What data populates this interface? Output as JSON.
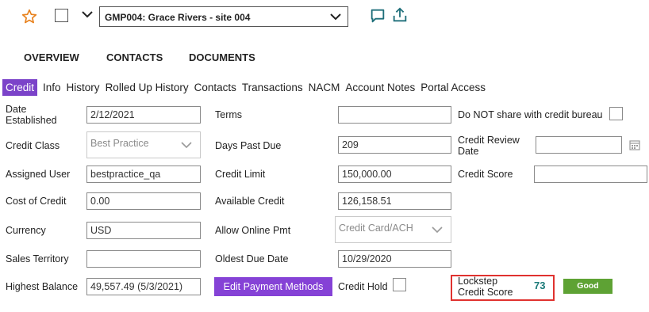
{
  "header": {
    "account_select": "GMP004: Grace Rivers - site 004"
  },
  "main_tabs": [
    "OVERVIEW",
    "CONTACTS",
    "DOCUMENTS"
  ],
  "sub_tabs": [
    "Credit",
    "Info",
    "History",
    "Rolled Up History",
    "Contacts",
    "Transactions",
    "NACM",
    "Account Notes",
    "Portal Access"
  ],
  "fields": {
    "date_established": {
      "label": "Date Established",
      "value": "2/12/2021"
    },
    "credit_class": {
      "label": "Credit Class",
      "value": "Best Practice"
    },
    "assigned_user": {
      "label": "Assigned User",
      "value": "bestpractice_qa"
    },
    "cost_of_credit": {
      "label": "Cost of Credit",
      "value": "0.00"
    },
    "currency": {
      "label": "Currency",
      "value": "USD"
    },
    "sales_territory": {
      "label": "Sales Territory",
      "value": ""
    },
    "highest_balance": {
      "label": "Highest Balance",
      "value": "49,557.49 (5/3/2021)"
    },
    "terms": {
      "label": "Terms",
      "value": ""
    },
    "days_past_due": {
      "label": "Days Past Due",
      "value": "209"
    },
    "credit_limit": {
      "label": "Credit Limit",
      "value": "150,000.00"
    },
    "available_credit": {
      "label": "Available Credit",
      "value": "126,158.51"
    },
    "allow_online_pmt": {
      "label": "Allow Online Pmt",
      "value": "Credit Card/ACH"
    },
    "oldest_due_date": {
      "label": "Oldest Due Date",
      "value": "10/29/2020"
    },
    "do_not_share": {
      "label": "Do NOT share with credit bureau"
    },
    "credit_review_date": {
      "label": "Credit Review Date",
      "value": ""
    },
    "credit_score": {
      "label": "Credit Score",
      "value": ""
    },
    "credit_hold": {
      "label": "Credit Hold"
    },
    "lockstep_score": {
      "label": "Lockstep Credit Score",
      "value": "73",
      "rating": "Good"
    }
  },
  "buttons": {
    "edit_payment_methods": "Edit Payment Methods"
  },
  "colors": {
    "accent_purple": "#7b43c9",
    "good_green": "#5ea234",
    "highlight_red": "#e0322f",
    "score_teal": "#1b7a78",
    "icon_orange": "#e8821e",
    "icon_teal": "#1f6f7a"
  }
}
